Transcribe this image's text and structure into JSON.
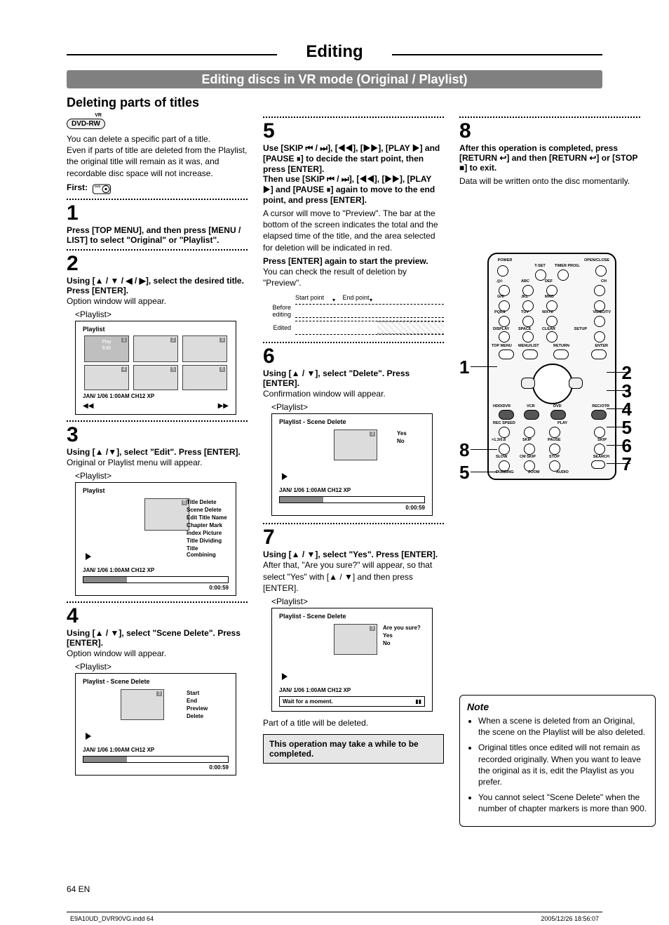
{
  "header": {
    "top": "Editing",
    "band": "Editing discs in VR mode (Original / Playlist)",
    "sub": "Deleting parts of titles"
  },
  "badges": {
    "dvd_rw": "DVD-RW"
  },
  "col1": {
    "intro1": "You can delete a specific part of a title.",
    "intro2": "Even if parts of title are deleted from the Playlist, the original title will remain as it was, and recordable disc space will not increase.",
    "first": "First:",
    "step1_num": "1",
    "step1_ttl": "Press [TOP MENU], and then press [MENU / LIST] to select \"Original\" or \"Playlist\".",
    "step2_num": "2",
    "step2_ttl": "Using [▲ / ▼ / ◀ / ▶], select the desired title. Press [ENTER].",
    "step2_note": "Option window will appear.",
    "caption_playlist": "<Playlist>",
    "playlist_scr": {
      "title": "Playlist",
      "thumbs": [
        {
          "n": "1",
          "play_edit": "Play\nEdit"
        },
        {
          "n": "2"
        },
        {
          "n": "3"
        },
        {
          "n": "4"
        },
        {
          "n": "5"
        },
        {
          "n": "6"
        }
      ],
      "info": "JAN/ 1/06 1:00AM CH12 XP",
      "pager_left": "◀◀",
      "pager_right": "▶▶"
    },
    "step3_num": "3",
    "step3_ttl": "Using [▲ /▼], select \"Edit\". Press [ENTER].",
    "step3_note": "Original or Playlist menu will appear.",
    "menu_scr": {
      "title": "Playlist",
      "thumb_n": "6",
      "menu": [
        "Title Delete",
        "Scene Delete",
        "Edit Title Name",
        "Chapter Mark",
        "Index Picture",
        "Title Dividing",
        "Title Combining"
      ],
      "info": "JAN/ 1/06 1:00AM CH12 XP",
      "time": "0:00:59"
    },
    "step4_num": "4",
    "step4_ttl": "Using [▲ / ▼], select \"Scene Delete\". Press [ENTER].",
    "step4_note": "Option window will appear.",
    "scene_scr": {
      "title": "Playlist - Scene Delete",
      "thumb_n": "3",
      "menu": [
        "Start",
        "End",
        "Preview",
        "Delete"
      ],
      "info": "JAN/ 1/06 1:00AM CH12 XP",
      "time": "0:00:59"
    }
  },
  "col2": {
    "step5_num": "5",
    "step5_ttl": "Use [SKIP ⏮ / ⏭], [◀◀], [▶▶], [PLAY ▶] and [PAUSE ⏸] to decide the start point, then press [ENTER].\nThen use [SKIP ⏮ / ⏭], [◀◀], [▶▶], [PLAY ▶] and [PAUSE ⏸] again to move to the end point, and press [ENTER].",
    "step5_p1": "A cursor will move to \"Preview\". The bar at the bottom of the screen indicates the total and the elapsed time of the title, and the area selected for deletion will be indicated in red.",
    "step5_p2": "Press [ENTER] again to start the preview.",
    "step5_p3": "You can check the result of deletion by \"Preview\".",
    "strip_start": "Start point",
    "strip_end": "End point",
    "before": "Before editing",
    "edited": "Edited",
    "step6_num": "6",
    "step6_ttl": "Using [▲ / ▼], select \"Delete\". Press [ENTER].",
    "step6_note": "Confirmation window will appear.",
    "caption_playlist": "<Playlist>",
    "del_scr": {
      "title": "Playlist - Scene Delete",
      "thumb_n": "3",
      "menu": [
        "Yes",
        "No"
      ],
      "info": "JAN/ 1/06 1:00AM CH12 XP",
      "time": "0:00:59"
    },
    "step7_num": "7",
    "step7_ttl": "Using [▲ / ▼], select \"Yes\". Press [ENTER].",
    "step7_p1": "After that, \"Are you sure?\" will appear, so that select \"Yes\" with [▲ / ▼] and then press [ENTER].",
    "sure_scr": {
      "title": "Playlist - Scene Delete",
      "thumb_n": "3",
      "menu": [
        "Are you sure?",
        "Yes",
        "No"
      ],
      "info": "JAN/ 1/06 1:00AM CH12 XP",
      "wait": "Wait for a moment."
    },
    "part_deleted": "Part of a title will be deleted.",
    "warn": "This operation may take a while to be completed."
  },
  "col3": {
    "step8_num": "8",
    "step8_ttl": "After this operation is completed, press [RETURN ↩] and then [RETURN ↩] or [STOP ■] to exit.",
    "step8_p": "Data will be written onto the disc momentarily."
  },
  "remote_nums": {
    "left": [
      "1",
      "8",
      "5"
    ],
    "right": [
      "2",
      "3",
      "4",
      "5",
      "6",
      "7"
    ]
  },
  "remote_labels": {
    "row0": [
      "POWER",
      "OPEN/CLOSE"
    ],
    "row0b": [
      "T-SET",
      "TIMER PROG."
    ],
    "digits_letters": [
      ".@/:",
      "ABC",
      "DEF",
      "GHI",
      "JKL",
      "MNO",
      "PQRS",
      "TUV",
      "WXYZ"
    ],
    "digits_right": [
      "CH",
      "VIDEO/TV"
    ],
    "row_disp": [
      "DISPLAY",
      "SPACE",
      "CLEAR",
      "SETUP"
    ],
    "row_menu": [
      "TOP MENU",
      "MENU/LIST",
      "RETURN",
      "ENTER"
    ],
    "row_mode": [
      "HDD/DVR",
      "VCR",
      "DVD",
      "REC/OTR"
    ],
    "row_play": [
      "REC SPEED",
      "PLAY"
    ],
    "row_transport": [
      "×1.3/0.8",
      "SKIP",
      "PAUSE",
      "SKIP"
    ],
    "row_last": [
      "SLOW",
      "CM SKIP",
      "STOP",
      "SEARCH"
    ],
    "row_bottom": [
      "DUBBING",
      "ZOOM",
      "AUDIO"
    ]
  },
  "note": {
    "title": "Note",
    "items": [
      "When a scene is deleted from an Original, the scene on the Playlist will be also deleted.",
      "Original titles once edited will not remain as recorded originally. When you want to leave the original as it is, edit the Playlist as you prefer.",
      "You cannot select \"Scene Delete\" when the number of chapter markers is more than 900."
    ]
  },
  "footer": {
    "page": "64   EN",
    "file": "E9A10UD_DVR90VG.indd   64",
    "stamp": "2005/12/26   18:56:07"
  }
}
